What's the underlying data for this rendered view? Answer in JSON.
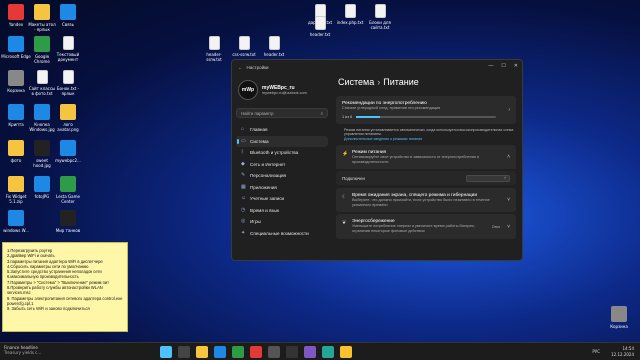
{
  "desktop_icons": [
    {
      "label": "Yandex",
      "color": "#e53935"
    },
    {
      "label": "Microsoft Edge",
      "color": "#1e88e5"
    },
    {
      "label": "Корзина",
      "color": "#888888"
    },
    {
      "label": "Крипта",
      "color": "#1e88e5"
    },
    {
      "label": "фото",
      "color": "#f5c542"
    },
    {
      "label": "Fix Widget 5.1.zip",
      "color": "#f5c542"
    },
    {
      "label": "windows W...",
      "color": "#1e88e5"
    },
    {
      "label": "Макеты атол - ярлык",
      "color": "#f5c542"
    },
    {
      "label": "Google Chrome",
      "color": "#2e9b48"
    },
    {
      "label": "Сайт классы в фото.txt",
      "color": "#f3f3f3"
    },
    {
      "label": "Кнопка Windows.jpg",
      "color": "#1e88e5"
    },
    {
      "label": "sweet hood.jpg",
      "color": "#222222"
    },
    {
      "label": "fotoJPG",
      "color": "#1e88e5"
    },
    {
      "label": "Связь",
      "color": "#1e88e5"
    },
    {
      "label": "Текстовый документ",
      "color": "#f3f3f3"
    },
    {
      "label": "Бонок.txt - ярлык",
      "color": "#f3f3f3"
    },
    {
      "label": "лого avatar.png",
      "color": "#f5c542"
    },
    {
      "label": "mywebpc2...",
      "color": "#1e88e5"
    },
    {
      "label": "Lesta Game Center",
      "color": "#2e9b48"
    },
    {
      "label": "Мир танков",
      "color": "#222222"
    },
    {
      "label": "дарасти.txt",
      "color": "#f3f3f3"
    },
    {
      "label": "header.txt",
      "color": "#f3f3f3"
    },
    {
      "label": "index.php.txt",
      "color": "#f3f3f3"
    },
    {
      "label": "Блоки для сайта.txt",
      "color": "#f3f3f3"
    },
    {
      "label": "header-ssrw.txt",
      "color": "#f3f3f3"
    },
    {
      "label": "css-ssrw.txt",
      "color": "#f3f3f3"
    },
    {
      "label": "header.txt",
      "color": "#f3f3f3"
    }
  ],
  "settings": {
    "title": "Настройки",
    "profile": {
      "initials": "mWp",
      "name": "myWEBpc_ru",
      "email": "mywebpc.ru@outlook.com"
    },
    "search_placeholder": "Найти параметр",
    "nav": [
      {
        "label": "Главная",
        "icon": "home-icon"
      },
      {
        "label": "Система",
        "icon": "system-icon",
        "active": true
      },
      {
        "label": "Bluetooth и устройства",
        "icon": "bluetooth-icon"
      },
      {
        "label": "Сеть и Интернет",
        "icon": "network-icon"
      },
      {
        "label": "Персонализация",
        "icon": "brush-icon"
      },
      {
        "label": "Приложения",
        "icon": "apps-icon"
      },
      {
        "label": "Учетные записи",
        "icon": "account-icon"
      },
      {
        "label": "Время и язык",
        "icon": "clock-icon"
      },
      {
        "label": "Игры",
        "icon": "gamepad-icon"
      },
      {
        "label": "Специальные возможности",
        "icon": "accessibility-icon"
      }
    ],
    "breadcrumb": {
      "parent": "Система",
      "sep": "›",
      "current": "Питание"
    },
    "recommend": {
      "title": "Рекомендации по энергопотреблению",
      "desc": "Снизьте углеродный след, применив эти рекомендации",
      "progress_label": "1 из 6",
      "progress": 0.17
    },
    "info_text": "Режим питания устанавливается автоматически, когда используется высокопроизводительная схема управления питанием.",
    "info_link": "Дополнительные сведения о режимах питания",
    "power_mode": {
      "title": "Режим питания",
      "desc": "Оптимизируйте свое устройство в зависимости от энергопотребления и производительности",
      "sub_label": "Подключен"
    },
    "sleep": {
      "title": "Время ожидания экрана, спящего режима и гибернации",
      "desc": "Выберите, что должно произойти, если устройство было неактивно в течение указанного времени"
    },
    "saver": {
      "title": "Энергосбережение",
      "desc": "Уменьшите потребление энергии и увеличьте время работы батареи, ограничив некоторые фоновые действия",
      "state": "Откл"
    }
  },
  "notes": [
    "1.Перезагрузить роутер",
    "2.драйвер WiFi и скачать",
    "3.параметры питания адаптера WiFi в диспетчере",
    "4.Сбросить параметры сети по умолчанию",
    "5.Запустите средство устранения неполадок сети",
    "6.максимальную производительность",
    "7.Параметры > \"Система\" > \"Выключение\" режим пит",
    "8.Проверить работу службы автонастройки WLAN services.msc",
    "9. Параметры электропитания сетевого адаптера control.exe powercfg.cpl,1",
    "9. Забыть сеть WiFi и заново подключиться"
  ],
  "taskbar": {
    "news_title": "Finance headline",
    "news_sub": "Treasury yields c...",
    "lang": "РУС",
    "time": "14:54",
    "date": "12.12.2024",
    "recycle_label": "Корзина"
  }
}
